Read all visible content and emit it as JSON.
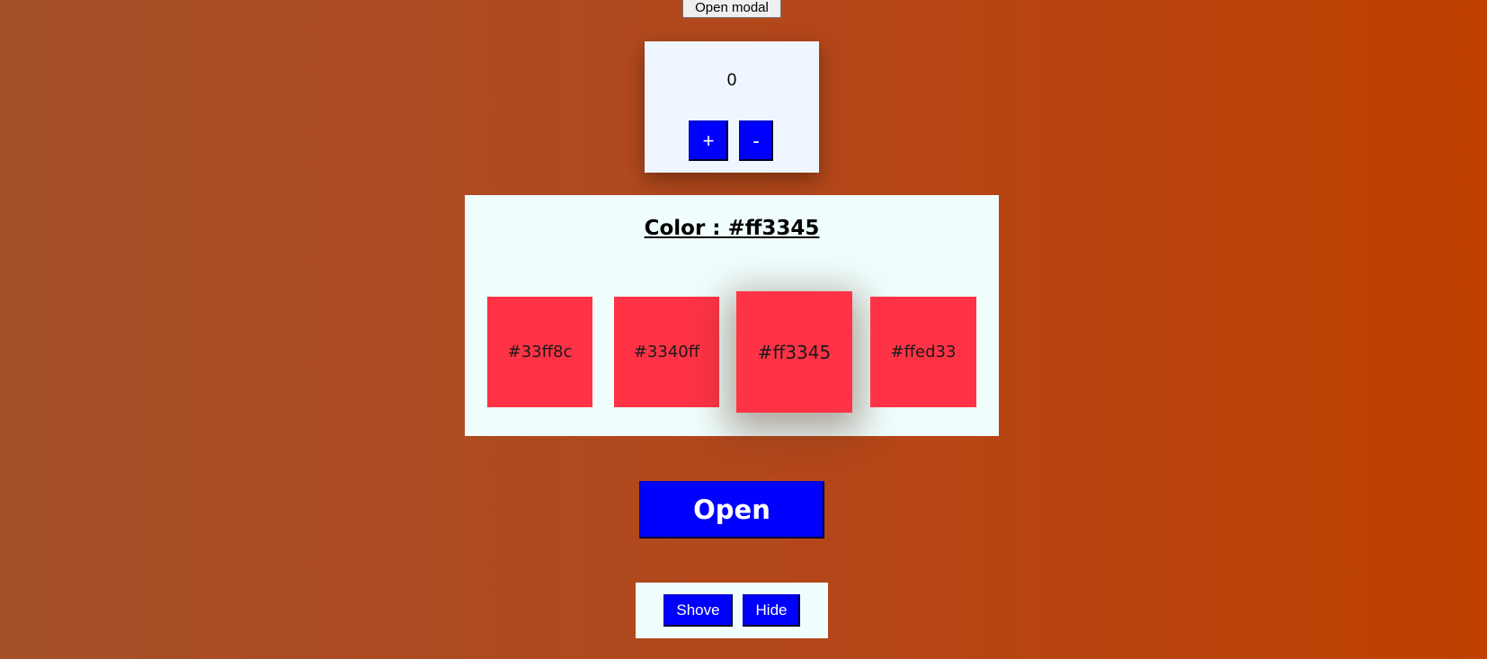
{
  "header": {
    "open_modal_label": "Open modal"
  },
  "counter": {
    "value": "0",
    "plus_label": "+",
    "minus_label": "-"
  },
  "color_picker": {
    "title": "Color : #ff3345",
    "selected_color": "#ff3345",
    "swatches": [
      {
        "label": "#33ff8c"
      },
      {
        "label": "#3340ff"
      },
      {
        "label": "#ff3345"
      },
      {
        "label": "#ffed33"
      }
    ]
  },
  "actions": {
    "open_label": "Open",
    "shove_label": "Shove",
    "hide_label": "Hide"
  },
  "colors": {
    "button_blue": "#0000ff",
    "swatch_fill": "#ff3345",
    "background_start": "#a5502a",
    "background_end": "#bf4000"
  }
}
